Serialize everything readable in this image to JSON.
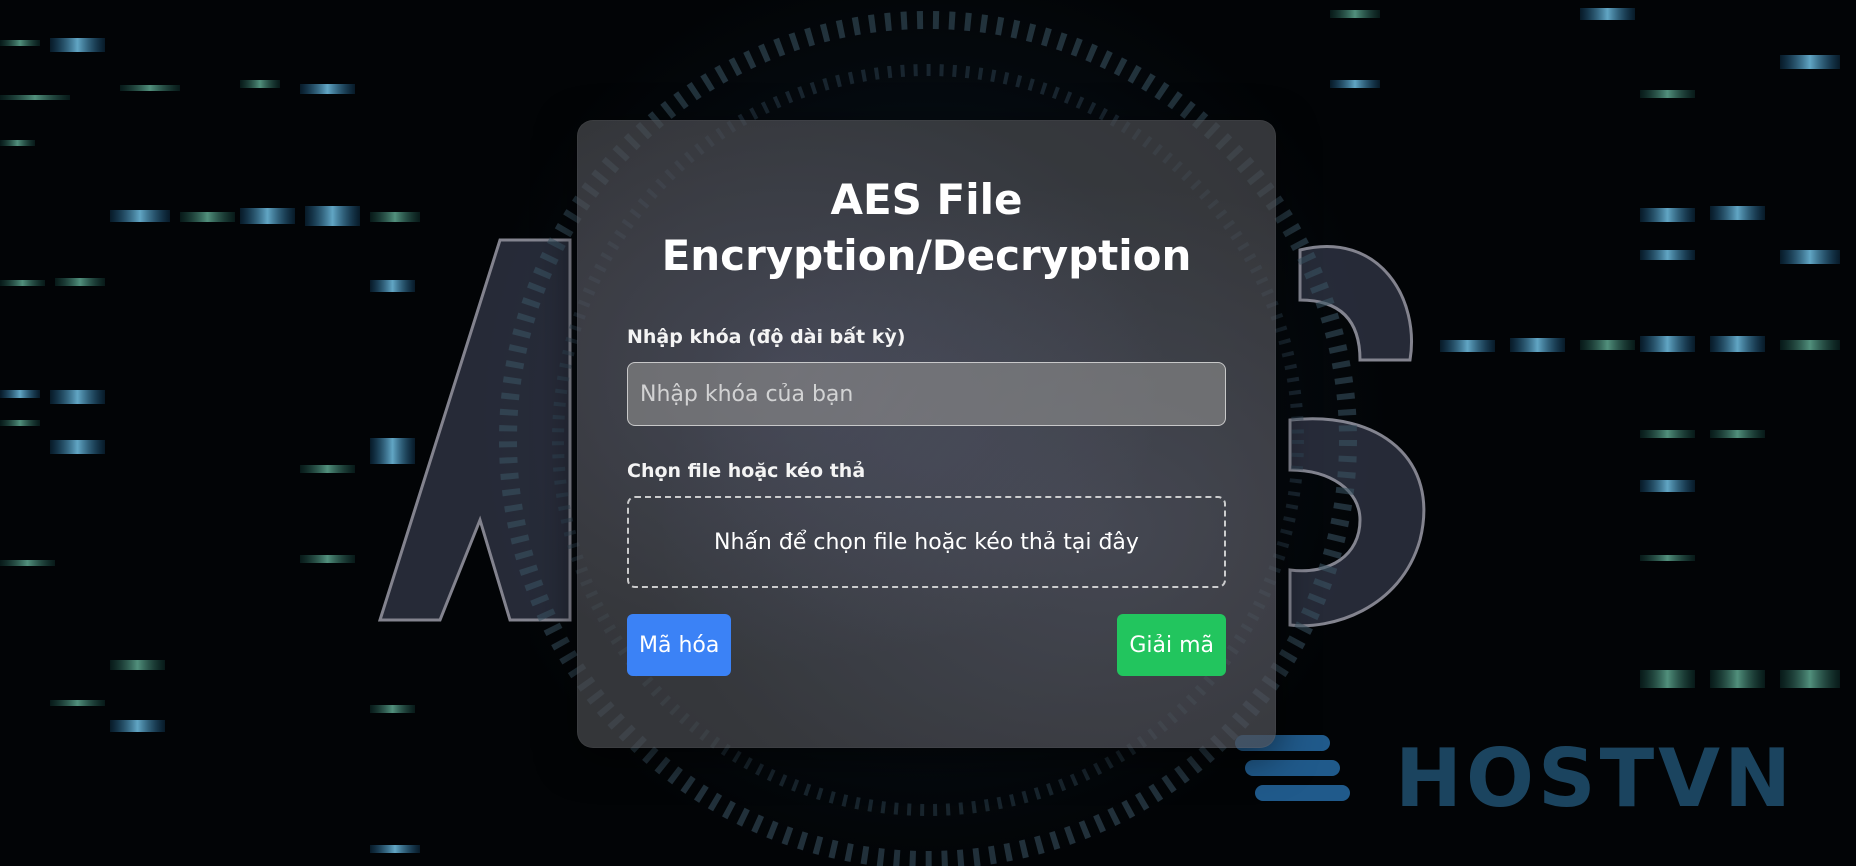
{
  "app": {
    "title": "AES File Encryption/Decryption"
  },
  "background": {
    "watermark_brand": "HOSTVN",
    "watermark_text": "AES"
  },
  "form": {
    "key_label": "Nhập khóa (độ dài bất kỳ)",
    "key_placeholder": "Nhập khóa của bạn",
    "key_value": "",
    "file_label": "Chọn file hoặc kéo thả",
    "drop_zone_text": "Nhấn để chọn file hoặc kéo thả tại đây",
    "encrypt_label": "Mã hóa",
    "decrypt_label": "Giải mã"
  },
  "colors": {
    "encrypt_button": "#3b82f6",
    "decrypt_button": "#22c55e",
    "panel_background": "#484a4e"
  }
}
